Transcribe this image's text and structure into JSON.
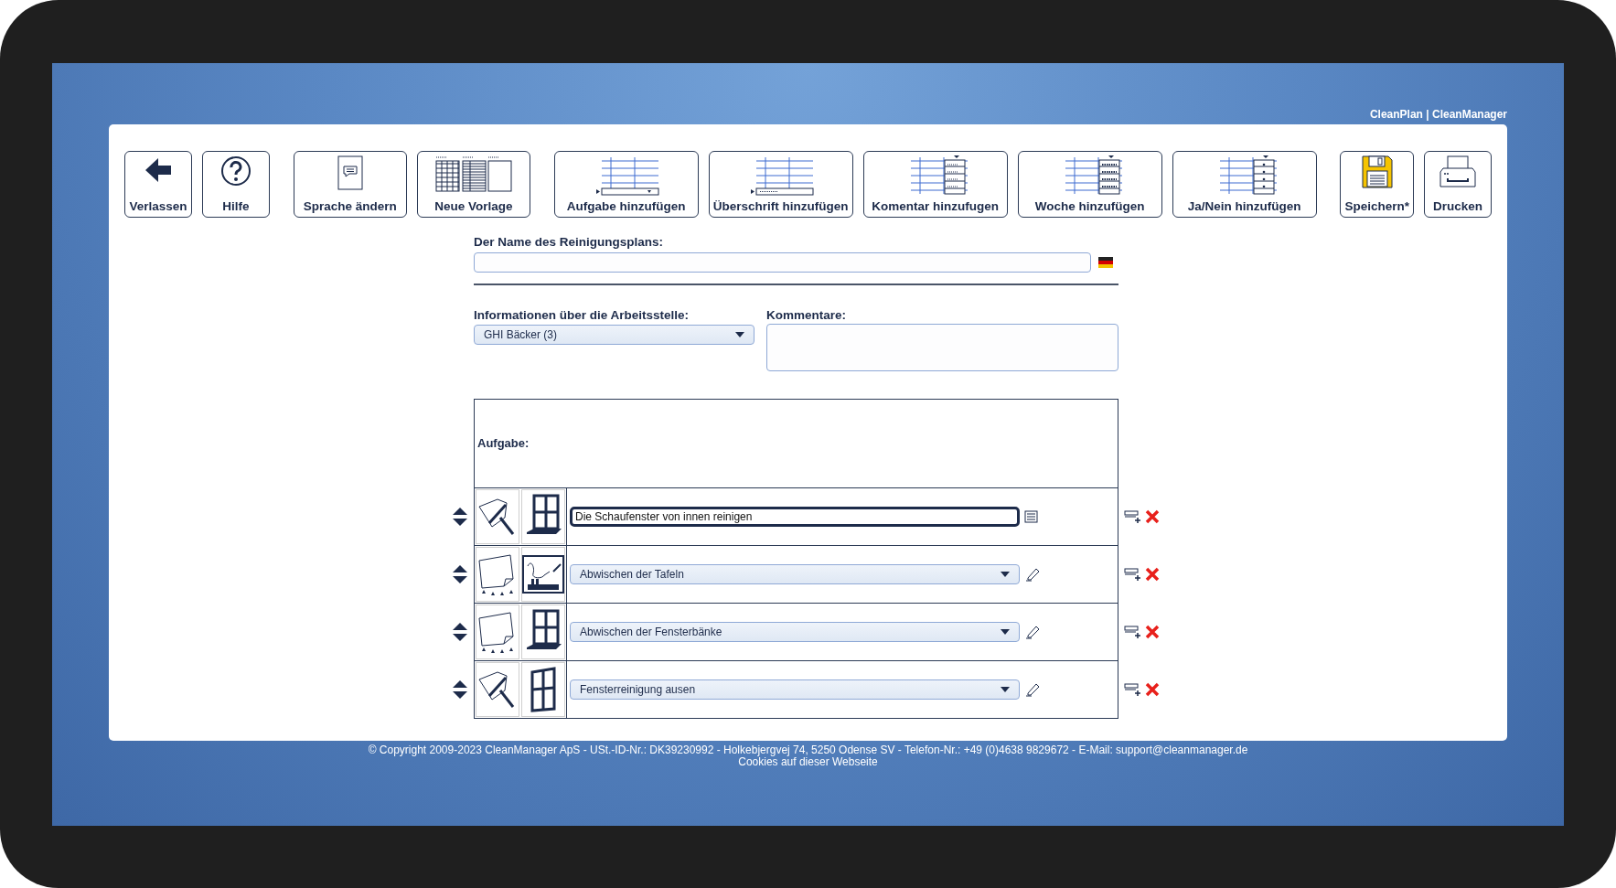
{
  "brand": "CleanPlan | CleanManager",
  "toolbar": [
    {
      "buttons": [
        {
          "label": "Verlassen",
          "kind": "exit"
        },
        {
          "label": "Hilfe",
          "kind": "help"
        }
      ]
    },
    {
      "buttons": [
        {
          "label": "Sprache ändern",
          "kind": "language"
        },
        {
          "label": "Neue Vorlage",
          "kind": "template"
        }
      ]
    },
    {
      "buttons": [
        {
          "label": "Aufgabe hinzufügen",
          "kind": "task"
        },
        {
          "label": "Überschrift hinzufügen",
          "kind": "heading"
        },
        {
          "label": "Komentar hinzufugen",
          "kind": "comment"
        },
        {
          "label": "Woche hinzufügen",
          "kind": "week"
        },
        {
          "label": "Ja/Nein hinzufügen",
          "kind": "yesno"
        }
      ]
    },
    {
      "buttons": [
        {
          "label": "Speichern*",
          "kind": "save"
        },
        {
          "label": "Drucken",
          "kind": "print"
        }
      ]
    }
  ],
  "plan_name": {
    "label": "Der Name des Reinigungsplans:"
  },
  "workplace": {
    "label": "Informationen über die Arbeitsstelle:",
    "value": "GHI Bäcker (3)"
  },
  "comments": {
    "label": "Kommentare:"
  },
  "tasks": {
    "header": "Aufgabe:",
    "rows": [
      {
        "kind": "text",
        "value": "Die Schaufenster von innen reinigen",
        "pictograms": [
          {
            "kind": "squeegee"
          },
          {
            "kind": "sill"
          }
        ]
      },
      {
        "kind": "select",
        "value": "Abwischen der Tafeln",
        "pictograms": [
          {
            "kind": "cloth"
          },
          {
            "kind": "board"
          }
        ]
      },
      {
        "kind": "select",
        "value": "Abwischen der Fensterbänke",
        "pictograms": [
          {
            "kind": "cloth"
          },
          {
            "kind": "sill"
          }
        ]
      },
      {
        "kind": "select",
        "value": "Fensterreinigung ausen",
        "pictograms": [
          {
            "kind": "squeegee"
          },
          {
            "kind": "window"
          }
        ]
      }
    ]
  },
  "footer": {
    "copyright": "© Copyright 2009-2023 CleanManager ApS - USt.-ID-Nr.: DK39230992 - Holkebjergvej 74, 5250 Odense SV - Telefon-Nr.: +49 (0)4638 9829672 - E-Mail: support@cleanmanager.de",
    "cookies": "Cookies auf dieser Webseite"
  }
}
